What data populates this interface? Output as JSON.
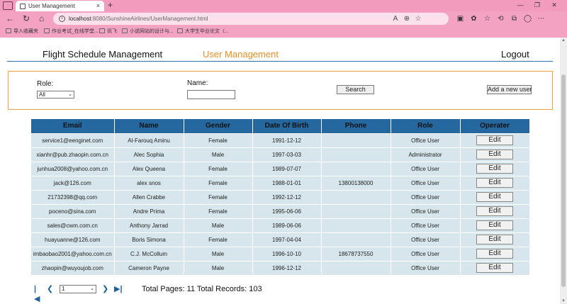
{
  "browser": {
    "tab_title": "User Management",
    "tab_close": "×",
    "new_tab": "+",
    "url_host": "localhost",
    "url_path": ":8080/SunshineAirlines/UserManagement.html",
    "bookmarks": [
      "导入收藏夹",
      "作业考试_在线学堂...",
      "讯飞",
      "小说网站的设计与...",
      "大学生毕业论文（..."
    ]
  },
  "nav": {
    "flight": "Flight Schedule Management",
    "user": "User Management",
    "logout": "Logout"
  },
  "filter": {
    "role_label": "Role:",
    "role_value": "All",
    "name_label": "Name:",
    "name_value": "",
    "search_label": "Search",
    "add_label": "Add a new user"
  },
  "table": {
    "headers": [
      "Email",
      "Name",
      "Gender",
      "Date Of Birth",
      "Phone",
      "Role",
      "Operater"
    ],
    "edit_label": "Edit",
    "rows": [
      {
        "email": "service1@eenginet.com",
        "name": "Al-Farouq Aminu",
        "gender": "Female",
        "dob": "1991-12-12",
        "phone": "",
        "role": "Office User"
      },
      {
        "email": "xianhr@pub.zhaopin.com.cn",
        "name": "Alec Sophia",
        "gender": "Male",
        "dob": "1997-03-03",
        "phone": "",
        "role": "Administrator"
      },
      {
        "email": "junhua2008@yahoo.com.cn",
        "name": "Alex Queena",
        "gender": "Female",
        "dob": "1989-07-07",
        "phone": "",
        "role": "Office User"
      },
      {
        "email": "jack@126.com",
        "name": "alex snos",
        "gender": "Female",
        "dob": "1988-01-01",
        "phone": "13800138000",
        "role": "Office User"
      },
      {
        "email": "21732398@qq.com",
        "name": "Allen Crabbe",
        "gender": "Female",
        "dob": "1992-12-12",
        "phone": "",
        "role": "Office User"
      },
      {
        "email": "poceno@sina.com",
        "name": "Andre Prima",
        "gender": "Female",
        "dob": "1995-06-06",
        "phone": "",
        "role": "Office User"
      },
      {
        "email": "sales@cwm.com.cn",
        "name": "Anthony Jarrad",
        "gender": "Male",
        "dob": "1989-06-06",
        "phone": "",
        "role": "Office User"
      },
      {
        "email": "huayuanne@126.com",
        "name": "Boris Simona",
        "gender": "Female",
        "dob": "1997-04-04",
        "phone": "",
        "role": "Office User"
      },
      {
        "email": "imbaobao2001@yahoo.com.cn",
        "name": "C.J. McCollum",
        "gender": "Male",
        "dob": "1996-10-10",
        "phone": "18678737550",
        "role": "Office User"
      },
      {
        "email": "zhaopin@wuyoujob.com",
        "name": "Cameron Payne",
        "gender": "Male",
        "dob": "1996-12-12",
        "phone": "",
        "role": "Office User"
      }
    ]
  },
  "pager": {
    "page_value": "1",
    "info": "Total Pages:   11 Total Records: 103"
  },
  "colors": {
    "header_bg": "#24689f",
    "row_bg": "#d6e6ec",
    "active_nav": "#e58f26",
    "filter_border": "#f0a142"
  }
}
